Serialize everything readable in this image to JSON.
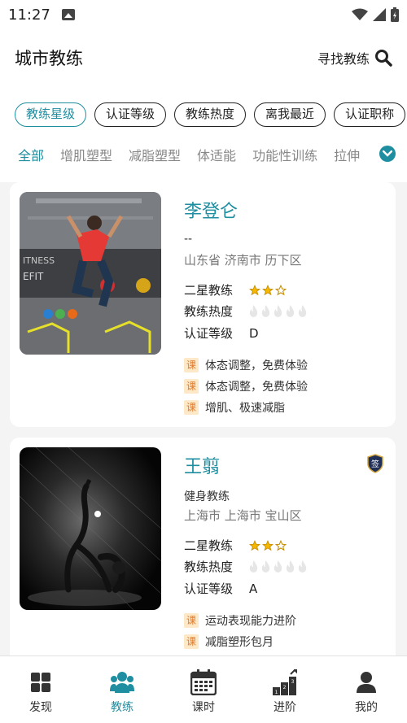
{
  "status_bar": {
    "time": "11:27"
  },
  "header": {
    "title": "城市教练",
    "find_label": "寻找教练"
  },
  "filter_chips": [
    "教练星级",
    "认证等级",
    "教练热度",
    "离我最近",
    "认证职称"
  ],
  "category_tabs": [
    "全部",
    "增肌塑型",
    "减脂塑型",
    "体适能",
    "功能性训练",
    "拉伸"
  ],
  "coaches": [
    {
      "name": "李登仑",
      "role": "--",
      "location": "山东省 济南市 历下区",
      "star_label": "二星教练",
      "star_rating": 2,
      "star_max": 3,
      "heat_label": "教练热度",
      "heat_level": 0,
      "heat_max": 5,
      "cert_label": "认证等级",
      "cert_value": "D",
      "course_tag": "课",
      "courses": [
        "体态调整，免费体验",
        "体态调整，免费体验",
        "增肌、极速减脂"
      ]
    },
    {
      "name": "王翦",
      "role": "健身教练",
      "location": "上海市 上海市 宝山区",
      "star_label": "二星教练",
      "star_rating": 2,
      "star_max": 3,
      "heat_label": "教练热度",
      "heat_level": 0,
      "heat_max": 5,
      "cert_label": "认证等级",
      "cert_value": "A",
      "course_tag": "课",
      "courses": [
        "运动表现能力进阶",
        "减脂塑形包月"
      ],
      "badge_text": "签"
    }
  ],
  "bottom_nav": [
    {
      "label": "发现",
      "icon": "grid-icon"
    },
    {
      "label": "教练",
      "icon": "people-icon"
    },
    {
      "label": "课时",
      "icon": "calendar-icon"
    },
    {
      "label": "进阶",
      "icon": "podium-icon"
    },
    {
      "label": "我的",
      "icon": "user-icon"
    }
  ],
  "colors": {
    "accent": "#1e8ea0",
    "star": "#f5b800",
    "tag_bg": "#fde9c8",
    "tag_text": "#e07b2e"
  }
}
